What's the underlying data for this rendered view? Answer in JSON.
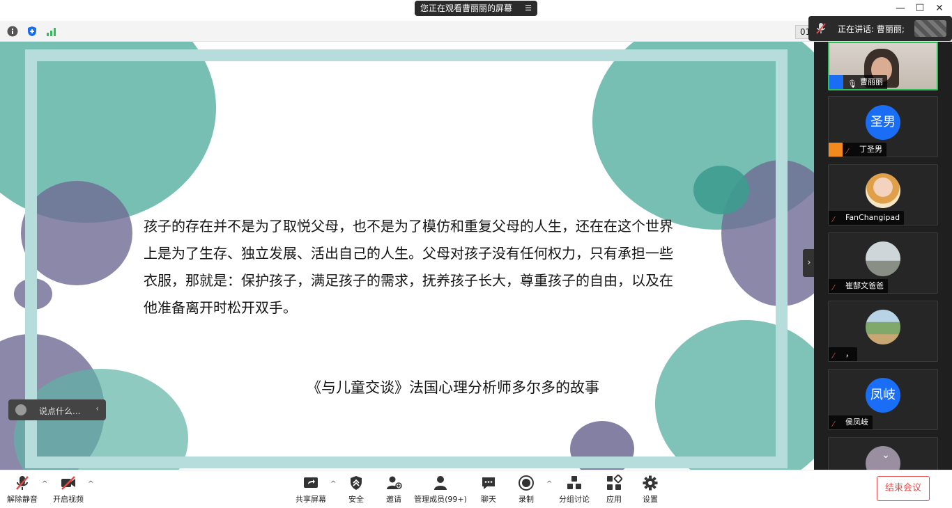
{
  "titlebar": {
    "sharing_notice": "您正在观看曹丽丽的屏幕",
    "minimize": "—",
    "maximize": "☐",
    "close": "✕"
  },
  "infobar": {
    "time_partial": "01"
  },
  "speaker": {
    "label": "正在讲话: 曹丽丽;"
  },
  "slide": {
    "body": "孩子的存在并不是为了取悦父母，也不是为了模仿和重复父母的人生，还在在这个世界上是为了生存、独立发展、活出自己的人生。父母对孩子没有任何权力，只有承担一些衣服，那就是：保护孩子，满足孩子的需求，抚养孩子长大，尊重孩子的自由，以及在他准备离开时松开双手。",
    "source": "《与儿童交谈》法国心理分析师多尔多的故事"
  },
  "chat": {
    "placeholder": "说点什么..."
  },
  "participants": [
    {
      "name": "曹丽丽",
      "avatar_text": "",
      "avatar_type": "video"
    },
    {
      "name": "丁圣男",
      "avatar_text": "圣男",
      "avatar_type": "text"
    },
    {
      "name": "FanChangipad",
      "avatar_text": "",
      "avatar_type": "photo"
    },
    {
      "name": "崔郜文爸爸",
      "avatar_text": "",
      "avatar_type": "photo"
    },
    {
      "name": "，",
      "avatar_text": "",
      "avatar_type": "photo"
    },
    {
      "name": "侯凤岐",
      "avatar_text": "凤岐",
      "avatar_type": "text"
    }
  ],
  "toolbar": {
    "unmute": "解除静音",
    "start_video": "开启视频",
    "share_screen": "共享屏幕",
    "security": "安全",
    "invite": "邀请",
    "manage_participants": "管理成员(99+)",
    "chat": "聊天",
    "record": "录制",
    "breakout": "分组讨论",
    "apps": "应用",
    "settings": "设置",
    "end_meeting": "结束会议"
  },
  "colors": {
    "accent_blue": "#1a6ef5",
    "end_red": "#e34b4b",
    "active_green": "#2fbf5a",
    "frame_teal": "#b7dcdc",
    "blob_teal": "#5fb3a6",
    "blob_purple": "#6f6a93"
  }
}
